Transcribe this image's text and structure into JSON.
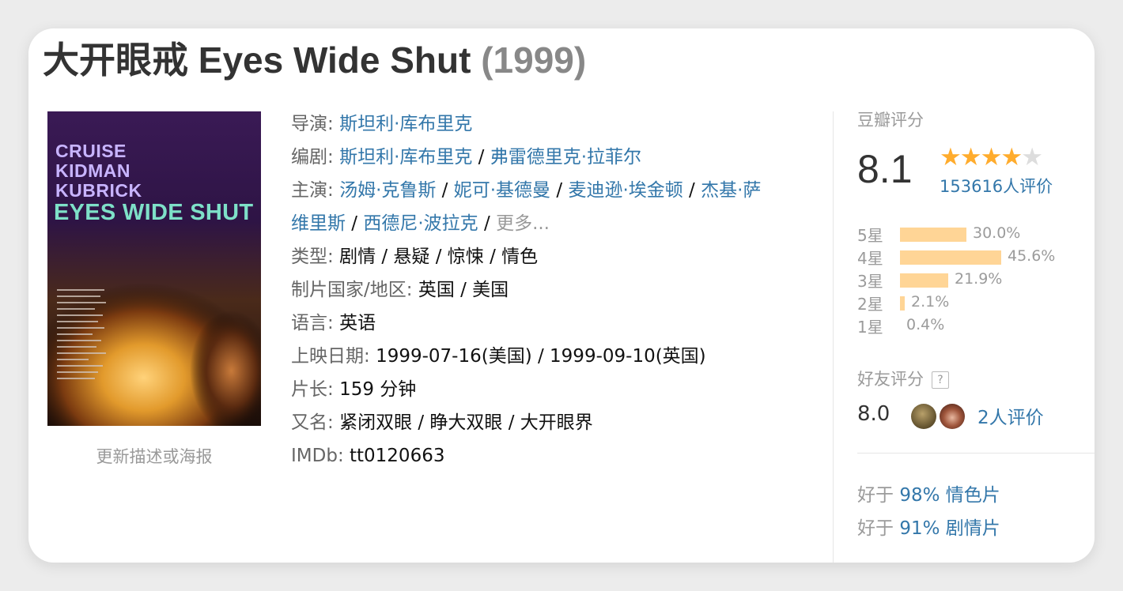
{
  "title": {
    "main": "大开眼戒 Eyes Wide Shut",
    "year": "(1999)"
  },
  "poster": {
    "names": [
      "CRUISE",
      "KIDMAN",
      "KUBRICK"
    ],
    "title": "EYES WIDE SHUT",
    "update_link": "更新描述或海报"
  },
  "info": {
    "director": {
      "label": "导演",
      "values": [
        "斯坦利·库布里克"
      ]
    },
    "writer": {
      "label": "编剧",
      "values": [
        "斯坦利·库布里克",
        "弗雷德里克·拉菲尔"
      ]
    },
    "cast": {
      "label": "主演",
      "line1": [
        "汤姆·克鲁斯",
        "妮可·基德曼",
        "麦迪逊·埃金顿",
        "杰基·萨"
      ],
      "line2": [
        "维里斯",
        "西德尼·波拉克"
      ],
      "more": "更多..."
    },
    "genre": {
      "label": "类型",
      "value": "剧情 / 悬疑 / 惊悚 / 情色"
    },
    "country": {
      "label": "制片国家/地区",
      "value": "英国 / 美国"
    },
    "language": {
      "label": "语言",
      "value": "英语"
    },
    "release": {
      "label": "上映日期",
      "value": "1999-07-16(美国) / 1999-09-10(英国)"
    },
    "runtime": {
      "label": "片长",
      "value": "159 分钟"
    },
    "aka": {
      "label": "又名",
      "value": "紧闭双眼 / 睁大双眼 / 大开眼界"
    },
    "imdb": {
      "label": "IMDb",
      "value": "tt0120663"
    }
  },
  "rating": {
    "label": "豆瓣评分",
    "score": "8.1",
    "stars_filled": 4,
    "stars_total": 5,
    "votes": "153616人评价",
    "distribution": [
      {
        "label": "5星",
        "percent": 30.0,
        "text": "30.0%"
      },
      {
        "label": "4星",
        "percent": 45.6,
        "text": "45.6%"
      },
      {
        "label": "3星",
        "percent": 21.9,
        "text": "21.9%"
      },
      {
        "label": "2星",
        "percent": 2.1,
        "text": "2.1%"
      },
      {
        "label": "1星",
        "percent": 0.4,
        "text": "0.4%"
      }
    ],
    "star_on_color": "#ffac2d",
    "bar_color": "#ffd596"
  },
  "friends": {
    "label": "好友评分",
    "help": "?",
    "score": "8.0",
    "count": "2人评价"
  },
  "better_than": [
    {
      "prefix": "好于",
      "link": "98% 情色片"
    },
    {
      "prefix": "好于",
      "link": "91% 剧情片"
    }
  ],
  "colors": {
    "link": "#3377aa",
    "muted": "#9b9b9b"
  }
}
